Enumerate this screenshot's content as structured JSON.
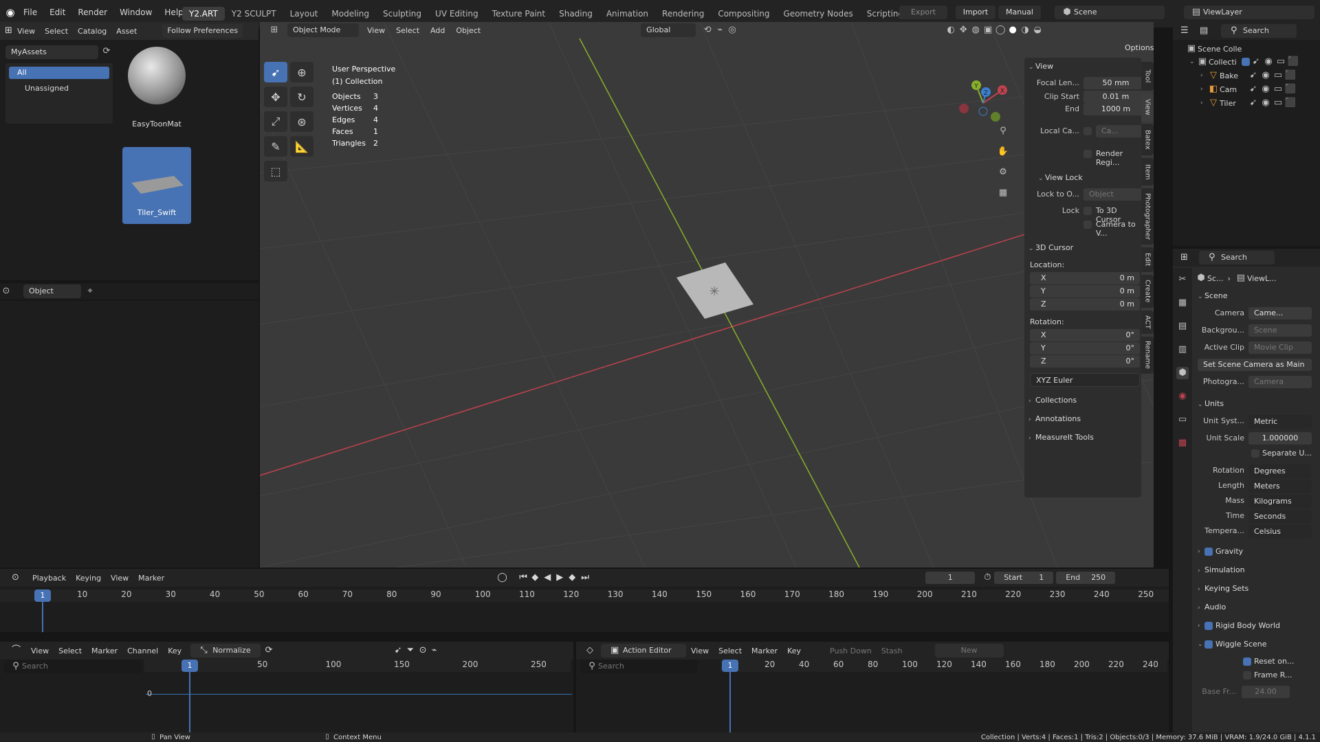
{
  "topbar": {
    "menus": [
      "File",
      "Edit",
      "Render",
      "Window",
      "Help"
    ],
    "workspaces": [
      "Y2.ART",
      "Y2 SCULPT",
      "Layout",
      "Modeling",
      "Sculpting",
      "UV Editing",
      "Texture Paint",
      "Shading",
      "Animation",
      "Rendering",
      "Compositing",
      "Geometry Nodes",
      "Scripting"
    ],
    "active_workspace": "Y2.ART",
    "add": "+",
    "export": "Export",
    "import": "Import",
    "manual": "Manual",
    "scene": "Scene",
    "viewlayer": "ViewLayer"
  },
  "assets": {
    "menus": [
      "View",
      "Select",
      "Catalog",
      "Asset"
    ],
    "follow": "Follow Preferences",
    "library": "MyAssets",
    "catalog_all": "All",
    "catalog_unassigned": "Unassigned",
    "items": [
      {
        "name": "EasyToonMat"
      },
      {
        "name": "Tiler_Swift"
      }
    ],
    "object": "Object"
  },
  "viewport": {
    "mode": "Object Mode",
    "menus": [
      "View",
      "Select",
      "Add",
      "Object"
    ],
    "transform": "Global",
    "options": "Options",
    "perspective": "User Perspective",
    "collection": "(1) Collection",
    "stats": [
      {
        "k": "Objects",
        "v": "3"
      },
      {
        "k": "Vertices",
        "v": "4"
      },
      {
        "k": "Edges",
        "v": "4"
      },
      {
        "k": "Faces",
        "v": "1"
      },
      {
        "k": "Triangles",
        "v": "2"
      }
    ],
    "gizmo": {
      "x": "X",
      "y": "Y",
      "z": "Z"
    }
  },
  "npanel": {
    "view": "View",
    "focal_label": "Focal Len...",
    "focal": "50 mm",
    "clip_start_label": "Clip Start",
    "clip_start": "0.01 m",
    "end_label": "End",
    "end": "1000 m",
    "local_cam": "Local Ca...",
    "local_cam_val": "Ca...",
    "render_region": "Render Regi...",
    "view_lock": "View Lock",
    "lock_to": "Lock to O...",
    "lock_obj": "Object",
    "lock": "Lock",
    "to_cursor": "To 3D Cursor",
    "cam_to_view": "Camera to V...",
    "cursor": "3D Cursor",
    "location": "Location:",
    "rotation": "Rotation:",
    "loc": [
      {
        "k": "X",
        "v": "0 m"
      },
      {
        "k": "Y",
        "v": "0 m"
      },
      {
        "k": "Z",
        "v": "0 m"
      }
    ],
    "rot": [
      {
        "k": "X",
        "v": "0°"
      },
      {
        "k": "Y",
        "v": "0°"
      },
      {
        "k": "Z",
        "v": "0°"
      }
    ],
    "euler": "XYZ Euler",
    "collections": "Collections",
    "annotations": "Annotations",
    "measureit": "MeasureIt Tools",
    "tabs": [
      "Tool",
      "View",
      "Batex",
      "Item",
      "Photographer",
      "Edit",
      "Create",
      "ACT",
      "Rename"
    ]
  },
  "outliner": {
    "search": "Search",
    "scene_coll": "Scene Colle",
    "collection": "Collecti",
    "items": [
      "Bake",
      "Cam",
      "Tiler"
    ]
  },
  "props": {
    "search": "Search",
    "crumb1": "Sc...",
    "crumb2": "ViewL...",
    "scene": "Scene",
    "camera_label": "Camera",
    "camera": "Came...",
    "bg_label": "Backgrou...",
    "bg": "Scene",
    "clip_label": "Active Clip",
    "clip": "Movie Clip",
    "set_cam": "Set Scene Camera as Main ...",
    "photo_label": "Photogra...",
    "photo": "Camera",
    "units": "Units",
    "unit_sys_label": "Unit Syst...",
    "unit_sys": "Metric",
    "unit_scale_label": "Unit Scale",
    "unit_scale": "1.000000",
    "separate": "Separate U...",
    "rotation_label": "Rotation",
    "rotation": "Degrees",
    "length_label": "Length",
    "length": "Meters",
    "mass_label": "Mass",
    "mass": "Kilograms",
    "time_label": "Time",
    "time": "Seconds",
    "temp_label": "Tempera...",
    "temp": "Celsius",
    "gravity": "Gravity",
    "simulation": "Simulation",
    "keying": "Keying Sets",
    "audio": "Audio",
    "rigid": "Rigid Body World",
    "wiggle": "Wiggle Scene",
    "reset": "Reset on...",
    "frame_r": "Frame R...",
    "base_fr_label": "Base Fr...",
    "base_fr": "24.00"
  },
  "timeline": {
    "menus": [
      "Playback",
      "Keying",
      "View",
      "Marker"
    ],
    "current": "1",
    "start_label": "Start",
    "start": "1",
    "end_label": "End",
    "end": "250",
    "ticks": [
      "10",
      "20",
      "30",
      "40",
      "50",
      "60",
      "70",
      "80",
      "90",
      "100",
      "110",
      "120",
      "130",
      "140",
      "150",
      "160",
      "170",
      "180",
      "190",
      "200",
      "210",
      "220",
      "230",
      "240",
      "250"
    ]
  },
  "graph": {
    "menus": [
      "View",
      "Select",
      "Marker",
      "Channel",
      "Key"
    ],
    "normalize": "Normalize",
    "search": "Search",
    "frame": "1",
    "ticks": [
      "50",
      "100",
      "150",
      "200",
      "250"
    ],
    "zero": "0"
  },
  "action": {
    "editor": "Action Editor",
    "menus": [
      "View",
      "Select",
      "Marker",
      "Key"
    ],
    "push": "Push Down",
    "stash": "Stash",
    "new": "New",
    "search": "Search",
    "frame": "1",
    "ticks": [
      "20",
      "40",
      "60",
      "80",
      "100",
      "120",
      "140",
      "160",
      "180",
      "200",
      "220",
      "240"
    ]
  },
  "status": {
    "pan": "Pan View",
    "context": "Context Menu",
    "info": "Collection | Verts:4 | Faces:1 | Tris:2 | Objects:0/3 | Memory: 37.6 MiB | VRAM: 1.9/24.0 GiB | 4.1.1"
  }
}
